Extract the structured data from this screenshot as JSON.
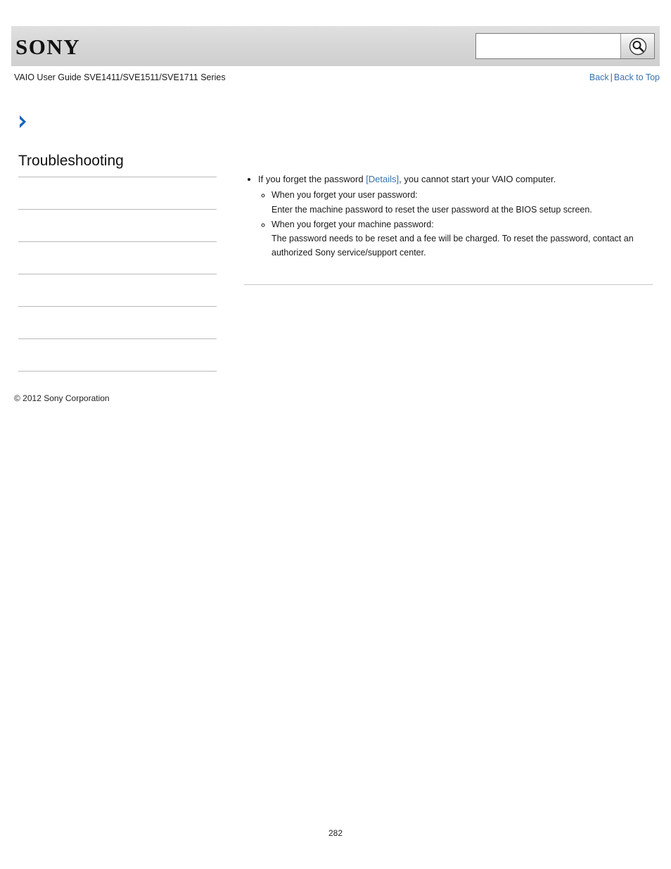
{
  "header": {
    "logo_text": "SONY",
    "search": {
      "value": "",
      "placeholder": "",
      "icon": "search-icon"
    }
  },
  "titlebar": {
    "guide_title": "VAIO User Guide SVE1411/SVE1511/SVE1711 Series",
    "back_label": "Back",
    "separator": "|",
    "back_to_top_label": "Back to Top"
  },
  "sidebar": {
    "section_title": "Troubleshooting",
    "divider_count": 7
  },
  "footer": {
    "copyright": "© 2012 Sony Corporation",
    "page_number": "282"
  },
  "main": {
    "items": [
      {
        "text_before": "If you forget the password ",
        "link": "[Details]",
        "text_after": ", you cannot start your VAIO computer.",
        "subitems": [
          {
            "heading": "When you forget your user password:",
            "body": "Enter the machine password to reset the user password at the BIOS setup screen."
          },
          {
            "heading": "When you forget your machine password:",
            "body": "The password needs to be reset and a fee will be charged. To reset the password, contact an authorized Sony service/support center."
          }
        ]
      }
    ]
  },
  "colors": {
    "link": "#3973ac",
    "header_bg": "#d8d8d8",
    "rule": "#b9b9b9"
  }
}
